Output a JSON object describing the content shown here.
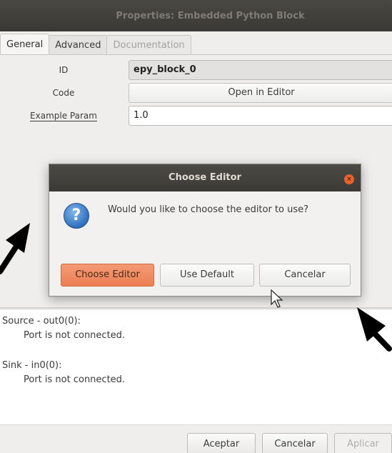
{
  "window": {
    "title": "Properties: Embedded Python Block"
  },
  "tabs": [
    {
      "label": "General",
      "state": "active"
    },
    {
      "label": "Advanced",
      "state": "normal"
    },
    {
      "label": "Documentation",
      "state": "disabled"
    }
  ],
  "params": {
    "id": {
      "label": "ID",
      "value": "epy_block_0"
    },
    "code": {
      "label": "Code",
      "button_label": "Open in Editor"
    },
    "example": {
      "label": "Example Param",
      "value": "1.0"
    }
  },
  "ports": {
    "source_head": "Source - out0(0):",
    "source_status": "Port is not connected.",
    "sink_head": "Sink - in0(0):",
    "sink_status": "Port is not connected."
  },
  "buttons": {
    "accept": "Aceptar",
    "cancel": "Cancelar",
    "apply": "Aplicar"
  },
  "dialog": {
    "title": "Choose Editor",
    "close_glyph": "×",
    "icon_glyph": "?",
    "message": "Would you like to choose the editor to use?",
    "choose_label": "Choose Editor",
    "default_label": "Use Default",
    "cancel_label": "Cancelar"
  },
  "colors": {
    "titlebar": "#3f3e3a",
    "primary_button": "#ec7f53",
    "close_button": "#e9622d",
    "question_icon": "#2f6fbd"
  }
}
